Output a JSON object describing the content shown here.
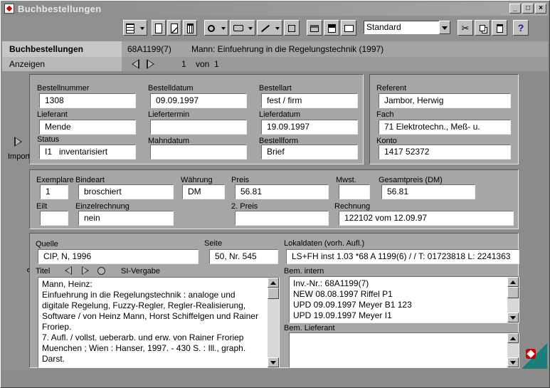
{
  "window": {
    "title": "Buchbestellungen"
  },
  "toolbar": {
    "layout_value": "Standard"
  },
  "header": {
    "module": "Buchbestellungen",
    "record_id": "68A1199(7)",
    "record_title": "Mann: Einfuehrung in die Regelungstechnik (1997)",
    "mode": "Anzeigen",
    "page_current": "1",
    "page_of": "von",
    "page_total": "1"
  },
  "side": {
    "import_label": "Import"
  },
  "order": {
    "bestellnummer": {
      "label": "Bestellnummer",
      "value": "1308"
    },
    "bestelldatum": {
      "label": "Bestelldatum",
      "value": "09.09.1997"
    },
    "bestellart": {
      "label": "Bestellart",
      "value": "fest / firm"
    },
    "lieferant": {
      "label": "Lieferant",
      "value": "Mende"
    },
    "liefertermin": {
      "label": "Liefertermin",
      "value": ""
    },
    "lieferdatum": {
      "label": "Lieferdatum",
      "value": "19.09.1997"
    },
    "status": {
      "label": "Status",
      "value": "I1   inventarisiert"
    },
    "mahndatum": {
      "label": "Mahndatum",
      "value": ""
    },
    "bestellform": {
      "label": "Bestellform",
      "value": "Brief"
    }
  },
  "referent": {
    "referent": {
      "label": "Referent",
      "value": "Jambor, Herwig"
    },
    "fach": {
      "label": "Fach",
      "value": "71 Elektrotechn., Meß- u."
    },
    "konto": {
      "label": "Konto",
      "value": "1417 52372"
    }
  },
  "price": {
    "exemplare": {
      "label": "Exemplare",
      "value": "1"
    },
    "bindeart": {
      "label": "Bindeart",
      "value": "broschiert"
    },
    "waehrung": {
      "label": "Währung",
      "value": "DM"
    },
    "preis": {
      "label": "Preis",
      "value": "56.81"
    },
    "mwst": {
      "label": "Mwst.",
      "value": ""
    },
    "gesamtpreis": {
      "label": "Gesamtpreis (DM)",
      "value": "56.81"
    },
    "eilt": {
      "label": "Eilt",
      "value": ""
    },
    "einzelrechnung": {
      "label": "Einzelrechnung",
      "value": "nein"
    },
    "preis2": {
      "label": "2. Preis",
      "value": ""
    },
    "rechnung": {
      "label": "Rechnung",
      "value": "122102 vom 12.09.97"
    }
  },
  "source": {
    "quelle": {
      "label": "Quelle",
      "value": "CIP, N, 1996"
    },
    "seite": {
      "label": "Seite",
      "value": "50, Nr. 545"
    },
    "lokaldaten": {
      "label": "Lokaldaten (vorh. Aufl.)",
      "value": "LS+FH inst 1.03 *68 A 1199(6) /  / T: 01723818 L: 2241363"
    },
    "titel_label": "Titel",
    "si_vergabe_label": "SI-Vergabe",
    "titel_lines": [
      "Mann, Heinz:",
      "Einfuehrung in die Regelungstechnik : analoge und",
      "digitale Regelung, Fuzzy-Regler, Regler-Realisierung,",
      "Software / von Heinz Mann, Horst Schiffelgen und Rainer",
      "Froriep.",
      "7. Aufl. / vollst. ueberarb. und erw. von Rainer Froriep",
      "Muenchen ; Wien : Hanser, 1997. - 430 S. : Ill., graph.",
      "Darst."
    ],
    "bem_intern_label": "Bem. intern",
    "bem_intern_lines": [
      "Inv.-Nr.: 68A1199(7)",
      "NEW 08.08.1997 Riffel P1",
      "UPD 09.09.1997 Meyer B1 123",
      "UPD 19.09.1997 Meyer I1"
    ],
    "bem_lieferant_label": "Bem. Lieferant"
  },
  "colors": {
    "panel": "#a6a6a6",
    "background": "#8c8c8c",
    "titlebar": "#8a8a8a"
  }
}
